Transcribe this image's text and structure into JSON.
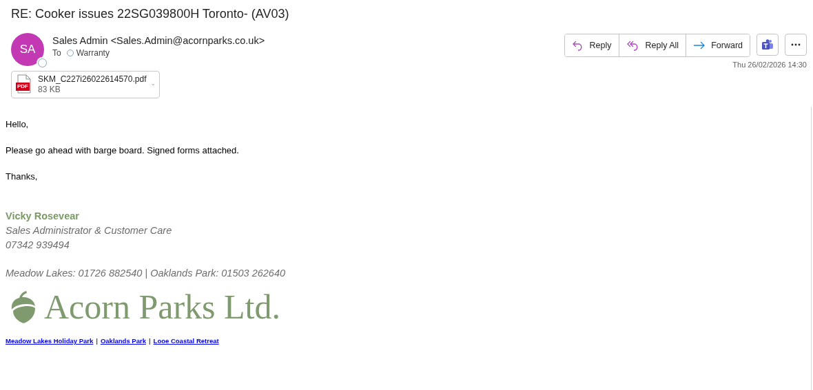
{
  "subject": "RE: Cooker issues 22SG039800H Toronto- (AV03)",
  "sender": {
    "initials": "SA",
    "name": "Sales Admin <Sales.Admin@acornparks.co.uk>"
  },
  "to_label": "To",
  "recipients": [
    {
      "name": "Warranty"
    }
  ],
  "attachment": {
    "badge": "PDF",
    "name": "SKM_C227i26022614570.pdf",
    "size": "83 KB"
  },
  "actions": [
    {
      "label": "Reply",
      "kind": "reply"
    },
    {
      "label": "Reply All",
      "kind": "reply_all"
    },
    {
      "label": "Forward",
      "kind": "forward"
    }
  ],
  "date": "Thu 26/02/2026 14:30",
  "body": {
    "paragraphs": [
      "Hello,",
      "Please go ahead with barge board. Signed forms attached.",
      "Thanks,"
    ],
    "signature": {
      "name": "Vicky Rosevear",
      "title": "Sales Administrator & Customer Care",
      "phone": "07342 939494",
      "offices": "Meadow Lakes: 01726 882540 | Oaklands Park: 01503 262640"
    },
    "logo_text": "Acorn Parks Ltd.",
    "links": [
      {
        "label": "Meadow Lakes Holiday Park"
      },
      {
        "label": "Oaklands Park"
      },
      {
        "label": "Looe Coastal Retreat"
      }
    ],
    "link_separator": "|"
  }
}
